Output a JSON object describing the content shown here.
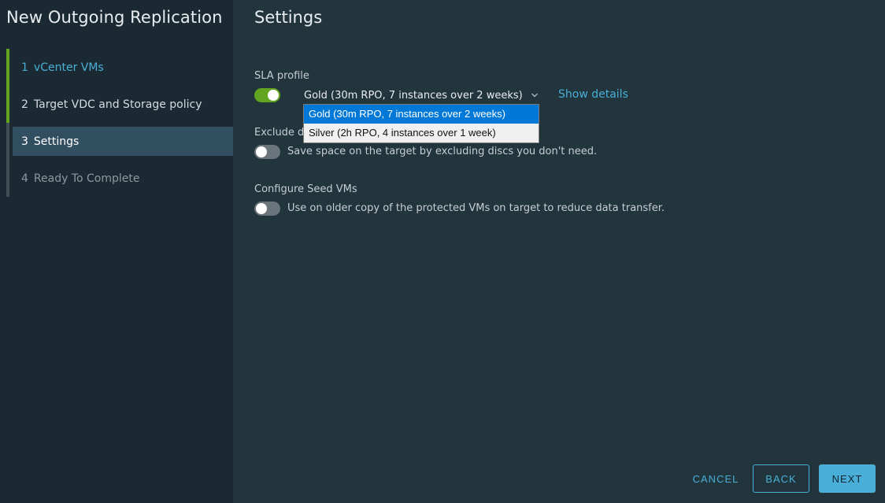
{
  "wizard": {
    "title": "New Outgoing Replication",
    "steps": [
      {
        "num": "1",
        "label": "vCenter VMs"
      },
      {
        "num": "2",
        "label": "Target VDC and Storage policy"
      },
      {
        "num": "3",
        "label": "Settings"
      },
      {
        "num": "4",
        "label": "Ready To Complete"
      }
    ]
  },
  "settings": {
    "title": "Settings",
    "sla": {
      "label": "SLA profile",
      "toggle_on": true,
      "selected": "Gold (30m RPO, 7 instances over 2 weeks)",
      "show_details": "Show details",
      "options": [
        "Gold (30m RPO, 7 instances over 2 weeks)",
        "Silver (2h RPO, 4 instances over 1 week)"
      ]
    },
    "exclude": {
      "label_visible": "Exclude d",
      "toggle_on": false,
      "description": "Save space on the target by excluding discs you don't need."
    },
    "seed": {
      "label": "Configure Seed VMs",
      "toggle_on": false,
      "description": "Use on older copy of the protected VMs on target to reduce data transfer."
    }
  },
  "footer": {
    "cancel": "CANCEL",
    "back": "BACK",
    "next": "NEXT"
  },
  "colors": {
    "accent": "#49afd9",
    "success": "#62a420",
    "sidebar_bg": "#1b2a32",
    "main_bg": "#22343c",
    "active_step_bg": "#324f61"
  }
}
